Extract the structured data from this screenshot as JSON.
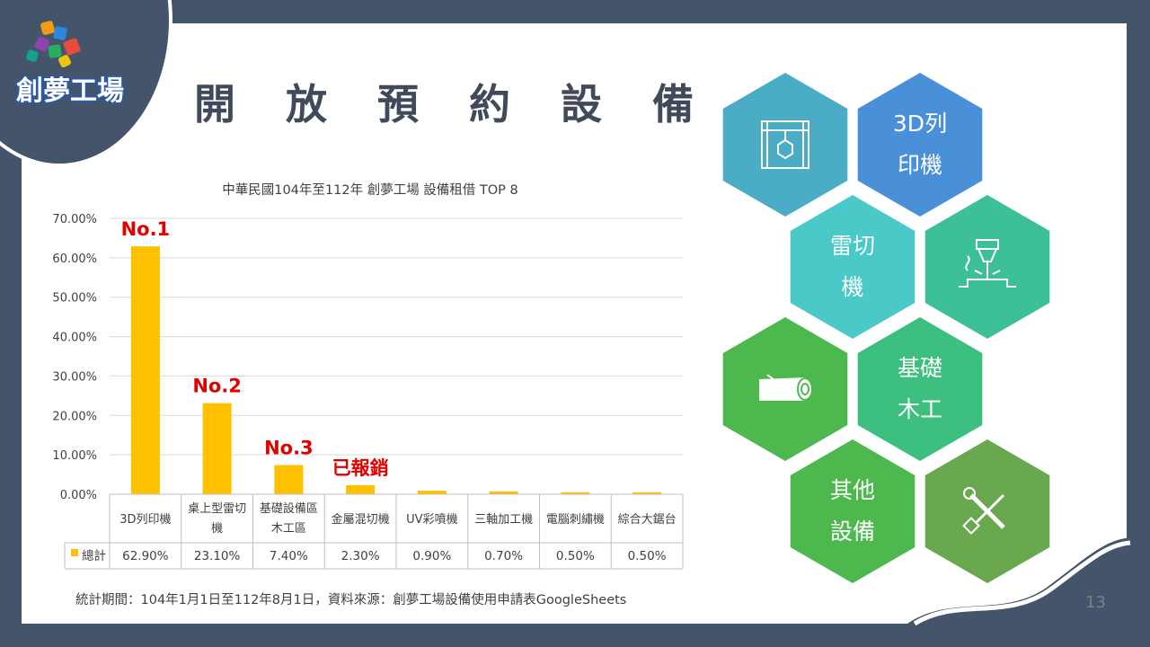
{
  "slide": {
    "title": "開 放 預 約 設 備",
    "logo_text": "創夢工場",
    "page_number": "13",
    "footnote": "統計期間：104年1月1日至112年8月1日，資料來源：創夢工場設備使用申請表GoogleSheets"
  },
  "chart_data": {
    "type": "bar",
    "title": "中華民國104年至112年 創夢工場 設備租借 TOP 8",
    "categories": [
      [
        "3D列印機"
      ],
      [
        "桌上型雷切",
        "機"
      ],
      [
        "基礎設備區",
        "木工區"
      ],
      [
        "金屬混切機"
      ],
      [
        "UV彩噴機"
      ],
      [
        "三軸加工機"
      ],
      [
        "電腦刺繡機"
      ],
      [
        "綜合大鋸台"
      ]
    ],
    "series": [
      {
        "name": "總計",
        "values": [
          62.9,
          23.1,
          7.4,
          2.3,
          0.9,
          0.7,
          0.5,
          0.5
        ],
        "color": "#ffc000"
      }
    ],
    "table_values": [
      "62.90%",
      "23.10%",
      "7.40%",
      "2.30%",
      "0.90%",
      "0.70%",
      "0.50%",
      "0.50%"
    ],
    "y_ticks": [
      "0.00%",
      "10.00%",
      "20.00%",
      "30.00%",
      "40.00%",
      "50.00%",
      "60.00%",
      "70.00%"
    ],
    "ylim": [
      0,
      70
    ],
    "grid": true,
    "annotations": [
      {
        "index": 0,
        "text": "No.1"
      },
      {
        "index": 1,
        "text": "No.2"
      },
      {
        "index": 2,
        "text": "No.3"
      },
      {
        "index": 3,
        "text": "已報銷"
      }
    ],
    "annotation_color": "#e00000"
  },
  "hexagons": [
    {
      "label": [
        "",
        ""
      ],
      "icon": "3d-printer-icon",
      "color": "#4bacc6"
    },
    {
      "label": [
        "3D列",
        "印機"
      ],
      "icon": "",
      "color": "#4a90d9"
    },
    {
      "label": [
        "雷切",
        "機"
      ],
      "icon": "",
      "color": "#4bc8c8"
    },
    {
      "label": [
        "",
        ""
      ],
      "icon": "laser-cutter-icon",
      "color": "#3dbf98"
    },
    {
      "label": [
        "",
        ""
      ],
      "icon": "wood-log-icon",
      "color": "#4db84d"
    },
    {
      "label": [
        "基礎",
        "木工"
      ],
      "icon": "",
      "color": "#3dbf80"
    },
    {
      "label": [
        "其他",
        "設備"
      ],
      "icon": "",
      "color": "#4db84d"
    },
    {
      "label": [
        "",
        ""
      ],
      "icon": "tools-icon",
      "color": "#6aa84f"
    }
  ]
}
